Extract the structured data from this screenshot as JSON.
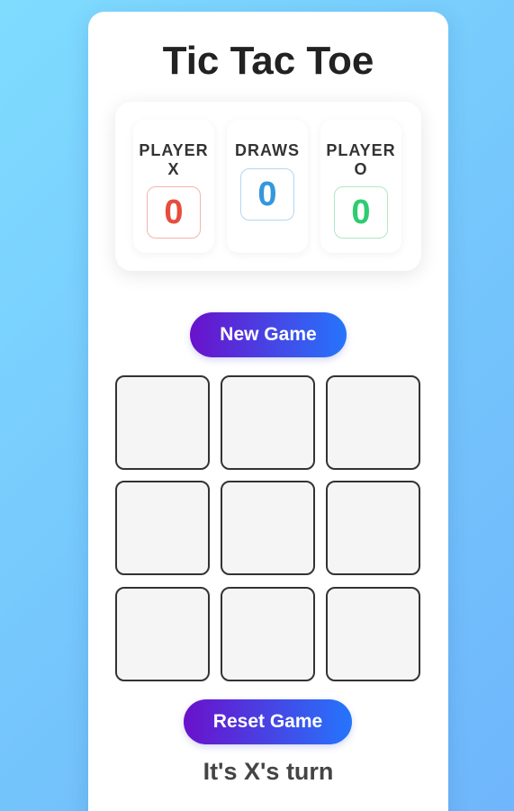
{
  "title": "Tic Tac Toe",
  "scoreboard": {
    "player_x": {
      "label": "PLAYER X",
      "value": "0",
      "color": "#e74c3c"
    },
    "draws": {
      "label": "DRAWS",
      "value": "0",
      "color": "#3498db"
    },
    "player_o": {
      "label": "PLAYER O",
      "value": "0",
      "color": "#2ecc71"
    }
  },
  "buttons": {
    "new_game": "New Game",
    "reset_game": "Reset Game"
  },
  "board": {
    "cells": [
      "",
      "",
      "",
      "",
      "",
      "",
      "",
      "",
      ""
    ]
  },
  "status": "It's X's turn",
  "colors": {
    "button_gradient_start": "#6a11cb",
    "button_gradient_end": "#2575fc",
    "background": "#7fdcff"
  }
}
